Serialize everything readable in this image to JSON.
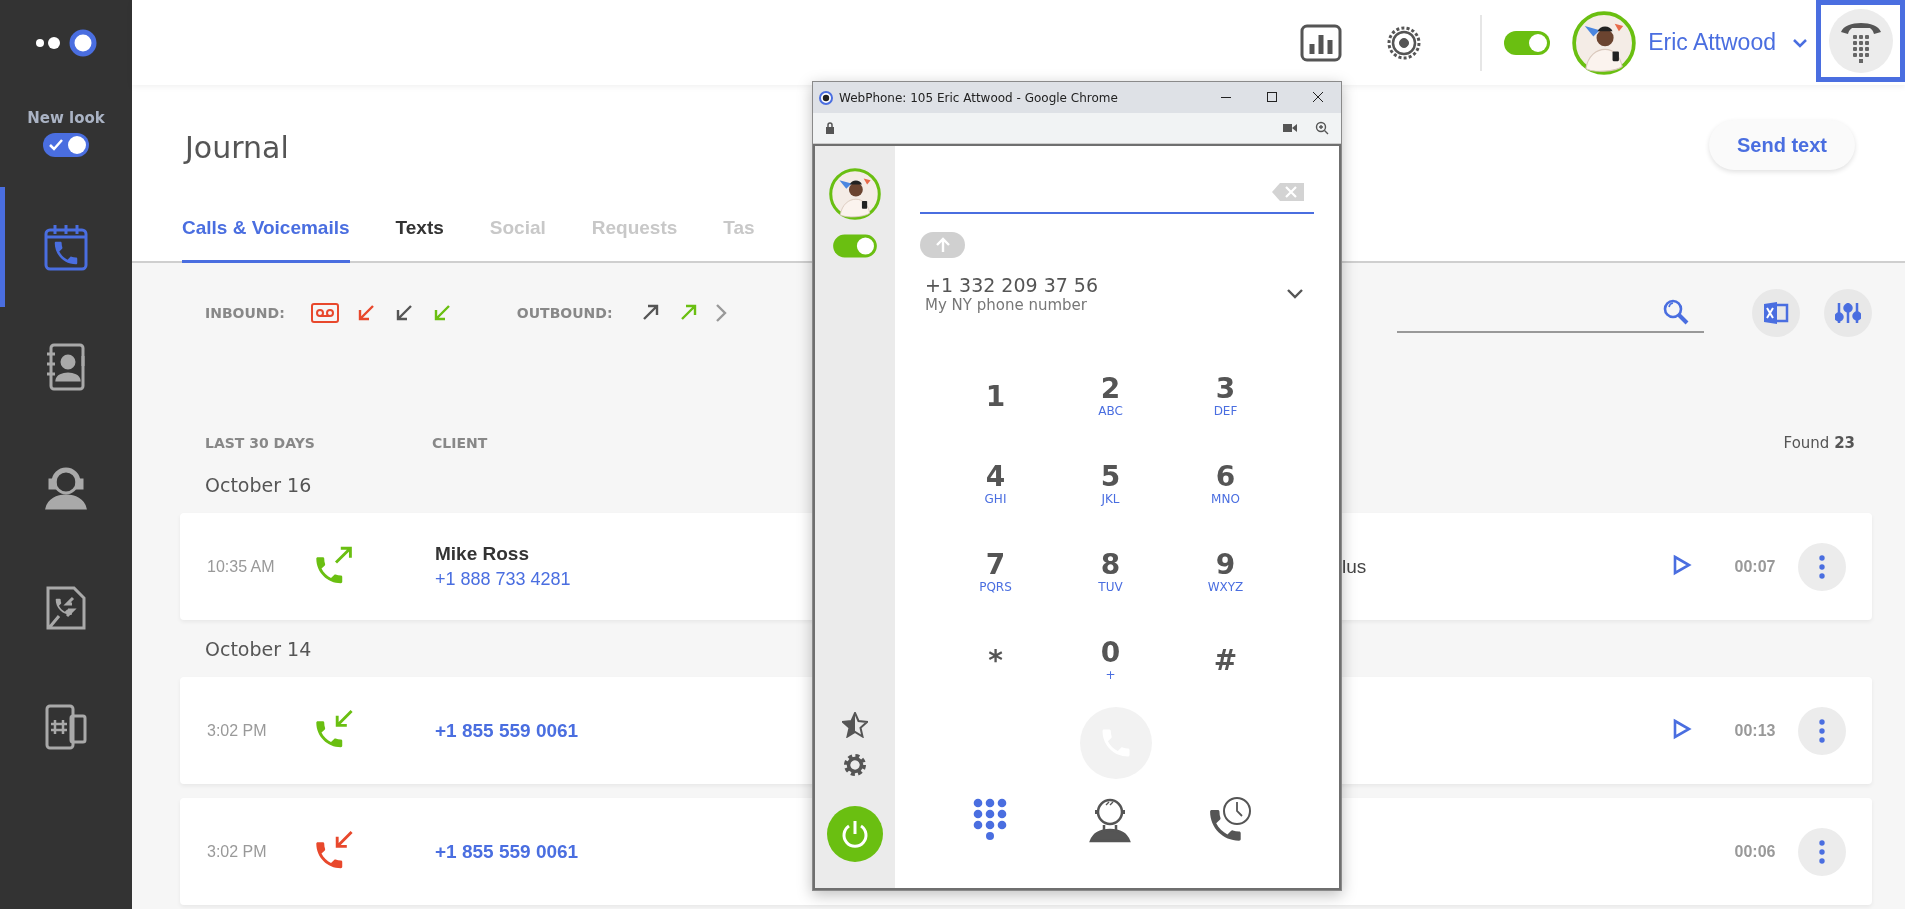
{
  "sidebar": {
    "new_look": {
      "label": "New look",
      "on": true
    },
    "items": [
      {
        "kind": "journal",
        "selected": true
      },
      {
        "kind": "contacts",
        "selected": false
      },
      {
        "kind": "agents",
        "selected": false
      },
      {
        "kind": "transfers",
        "selected": false
      },
      {
        "kind": "numbers",
        "selected": false
      }
    ]
  },
  "header": {
    "status_on": true,
    "user_name": "Eric Attwood"
  },
  "journal": {
    "title": "Journal",
    "send_button": "Send text",
    "tabs": [
      {
        "label": "Calls & Voicemails",
        "selected": true,
        "disabled": false
      },
      {
        "label": "Texts",
        "selected": false,
        "disabled": false
      },
      {
        "label": "Social",
        "selected": false,
        "disabled": true
      },
      {
        "label": "Requests",
        "selected": false,
        "disabled": true
      },
      {
        "label": "Tas",
        "selected": false,
        "disabled": true
      }
    ],
    "filters": {
      "inbound_label": "INBOUND:",
      "inbound": [
        {
          "kind": "voicemail",
          "color": "#e8482c"
        },
        {
          "kind": "arrow-in",
          "color": "#e8482c"
        },
        {
          "kind": "arrow-in",
          "color": "#555555"
        },
        {
          "kind": "arrow-in",
          "color": "#6abf11"
        }
      ],
      "outbound_label": "OUTBOUND:",
      "outbound": [
        {
          "kind": "arrow-out",
          "color": "#555555"
        },
        {
          "kind": "arrow-out",
          "color": "#6abf11"
        }
      ]
    },
    "columns": [
      "LAST 30 DAYS",
      "CLIENT"
    ],
    "found": "Found **23**",
    "groups": [
      {
        "date": "October 16",
        "calls": [
          {
            "time": "10:35 AM",
            "kind": "outbound",
            "color": "#6abf11",
            "name": "Mike Ross",
            "number": "+1 888 733 4281",
            "column_3": "lus",
            "has_recording": true,
            "duration": "00:07"
          }
        ]
      },
      {
        "date": "October 14",
        "calls": [
          {
            "time": "3:02 PM",
            "kind": "inbound",
            "color": "#6abf11",
            "number": "+1 855 559 0061",
            "has_recording": true,
            "duration": "00:13"
          },
          {
            "time": "3:02 PM",
            "kind": "inbound",
            "color": "#e8482c",
            "number": "+1 855 559 0061",
            "has_recording": false,
            "duration": "00:06"
          }
        ]
      }
    ]
  },
  "webphone": {
    "window_title": "WebPhone: 105 Eric Attwood - Google Chrome",
    "status_on": true,
    "caller_id": "+1 332 209 37 56",
    "caller_label": "My NY phone number",
    "keys": [
      {
        "digit": "1"
      },
      {
        "digit": "2",
        "letters": "ABC"
      },
      {
        "digit": "3",
        "letters": "DEF"
      },
      {
        "digit": "4",
        "letters": "GHI"
      },
      {
        "digit": "5",
        "letters": "JKL"
      },
      {
        "digit": "6",
        "letters": "MNO"
      },
      {
        "digit": "7",
        "letters": "PQRS"
      },
      {
        "digit": "8",
        "letters": "TUV"
      },
      {
        "digit": "9",
        "letters": "WXYZ"
      },
      {
        "digit": "*"
      },
      {
        "digit": "0",
        "letters": "+"
      },
      {
        "digit": "#"
      }
    ]
  }
}
